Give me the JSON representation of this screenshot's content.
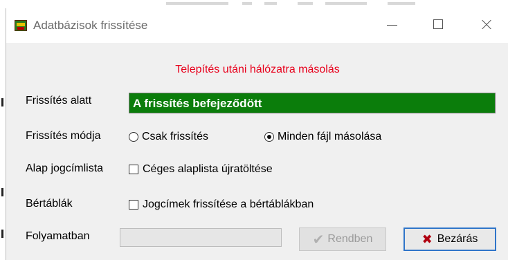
{
  "window": {
    "title": "Adatbázisok frissítése"
  },
  "subtitle": "Telepítés utáni hálózatra másolás",
  "fields": {
    "update_label": "Frissítés alatt",
    "update_status": "A frissítés befejeződött",
    "mode_label": "Frissítés módja",
    "mode_options": [
      {
        "label": "Csak frissítés",
        "checked": false
      },
      {
        "label": "Minden fájl másolása",
        "checked": true
      }
    ],
    "base_label": "Alap jogcímlista",
    "base_option": {
      "label": "Céges alaplista újratöltése",
      "checked": false
    },
    "wage_label": "Bértáblák",
    "wage_option": {
      "label": "Jogcímek frissítése a bértáblákban",
      "checked": false
    },
    "progress_label": "Folyamatban",
    "progress_fraction": 0
  },
  "buttons": {
    "ok_label": "Rendben",
    "ok_enabled": false,
    "close_label": "Bezárás"
  },
  "icons": {
    "app": "app-icon",
    "ok": "check-icon",
    "close": "x-icon"
  },
  "colors": {
    "status_bg": "#0b7d0b",
    "subtitle": "#e8001c",
    "close_x": "#b00010",
    "focus_border": "#2f75c9"
  }
}
